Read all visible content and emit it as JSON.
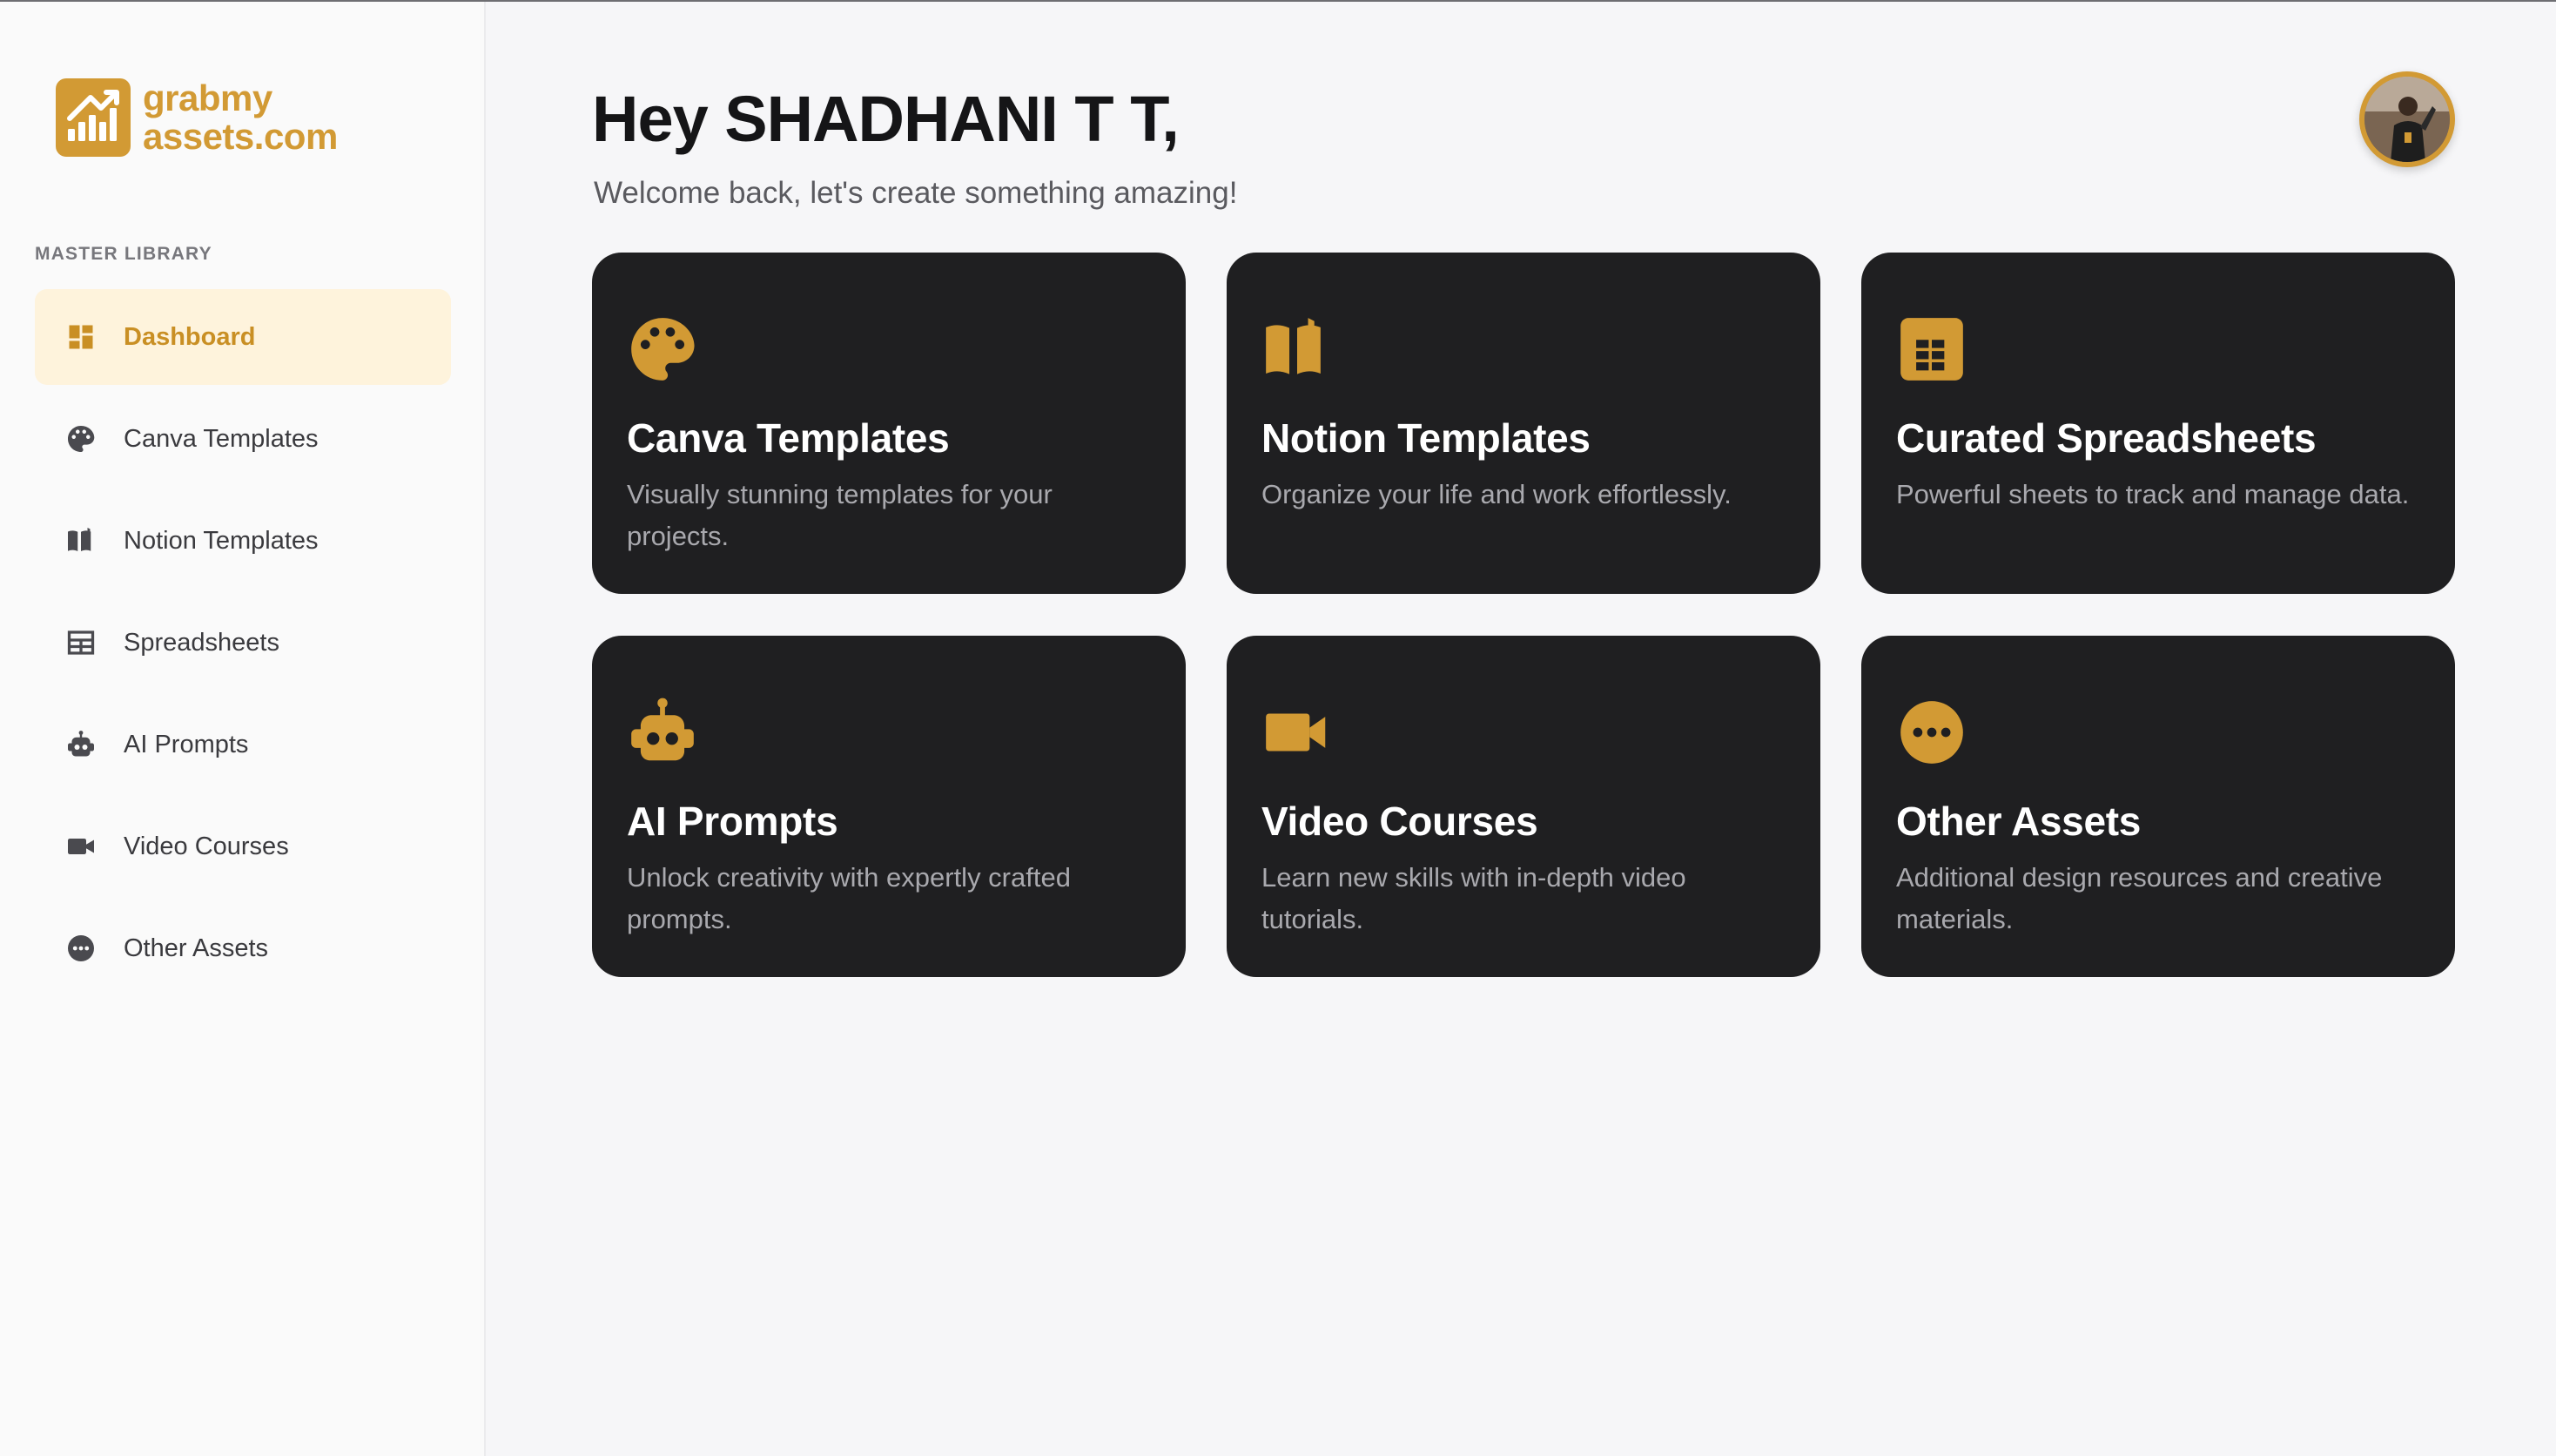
{
  "brand": {
    "logo_line1": "grabmy",
    "logo_line2": "assets.com",
    "accent_color": "#d29a34"
  },
  "sidebar": {
    "section_label": "MASTER LIBRARY",
    "items": [
      {
        "label": "Dashboard",
        "icon": "dashboard-icon",
        "active": true
      },
      {
        "label": "Canva Templates",
        "icon": "palette-icon",
        "active": false
      },
      {
        "label": "Notion Templates",
        "icon": "book-icon",
        "active": false
      },
      {
        "label": "Spreadsheets",
        "icon": "table-icon",
        "active": false
      },
      {
        "label": "AI Prompts",
        "icon": "robot-icon",
        "active": false
      },
      {
        "label": "Video Courses",
        "icon": "video-camera-icon",
        "active": false
      },
      {
        "label": "Other Assets",
        "icon": "more-icon",
        "active": false
      }
    ]
  },
  "header": {
    "greeting": "Hey SHADHANI T T,",
    "subtitle": "Welcome back, let's create something amazing!"
  },
  "cards": [
    {
      "title": "Canva Templates",
      "description": "Visually stunning templates for your projects.",
      "icon": "palette-icon"
    },
    {
      "title": "Notion Templates",
      "description": "Organize your life and work effortlessly.",
      "icon": "book-icon"
    },
    {
      "title": "Curated Spreadsheets",
      "description": "Powerful sheets to track and manage data.",
      "icon": "spreadsheet-icon"
    },
    {
      "title": "AI Prompts",
      "description": "Unlock creativity with expertly crafted prompts.",
      "icon": "robot-icon"
    },
    {
      "title": "Video Courses",
      "description": "Learn new skills with in-depth video tutorials.",
      "icon": "video-camera-icon"
    },
    {
      "title": "Other Assets",
      "description": "Additional design resources and creative materials.",
      "icon": "more-icon"
    }
  ]
}
